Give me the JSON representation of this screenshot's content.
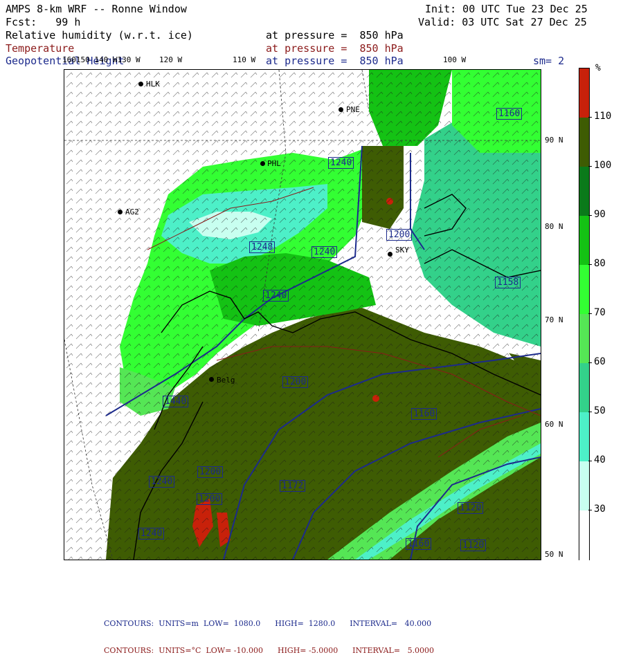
{
  "header": {
    "title": "AMPS 8-km WRF -- Ronne Window",
    "init": "Init: 00 UTC Tue 23 Dec 25",
    "fcst": "Fcst:   99 h",
    "valid": "Valid: 03 UTC Sat 27 Dec 25",
    "field1": "Relative humidity (w.r.t. ice)",
    "field2": "Temperature",
    "field3": "Geopotential Height",
    "level1": "at pressure =  850 hPa",
    "level2": "at pressure =  850 hPa",
    "level3": "at pressure =  850 hPa",
    "smoothing": "sm= 2"
  },
  "lon_labels": [
    "160150 140 W130 W",
    "120 W",
    "110 W",
    "100 W"
  ],
  "lat_labels": [
    "90 N",
    "80 N",
    "70 N",
    "60 N",
    "50 N"
  ],
  "colorbar": {
    "unit": "%",
    "labels": [
      "110",
      "100",
      "90",
      "80",
      "70",
      "60",
      "50",
      "40",
      "30"
    ],
    "colors": [
      "#c8210a",
      "#3e5c03",
      "#0a7a1a",
      "#14c214",
      "#33ff33",
      "#55e655",
      "#33d18a",
      "#4df0c8",
      "#c8fff0",
      "#ffffff"
    ]
  },
  "stations": [
    {
      "name": "HLK"
    },
    {
      "name": "PNE"
    },
    {
      "name": "PHL"
    },
    {
      "name": "AG2"
    },
    {
      "name": "SKY"
    },
    {
      "name": "Belg"
    }
  ],
  "height_labels": [
    "1160",
    "1240",
    "1200",
    "1248",
    "1240",
    "1240",
    "1200",
    "1160",
    "1440",
    "1200",
    "1200",
    "1172",
    "1120",
    "1160",
    "1120",
    "1240",
    "1240",
    "1158"
  ],
  "footer": {
    "line1": "CONTOURS:  UNITS=m  LOW=  1080.0      HIGH=  1280.0      INTERVAL=   40.000",
    "line2": "CONTOURS:  UNITS=°C  LOW= -10.000      HIGH= -5.0000      INTERVAL=   5.0000"
  }
}
